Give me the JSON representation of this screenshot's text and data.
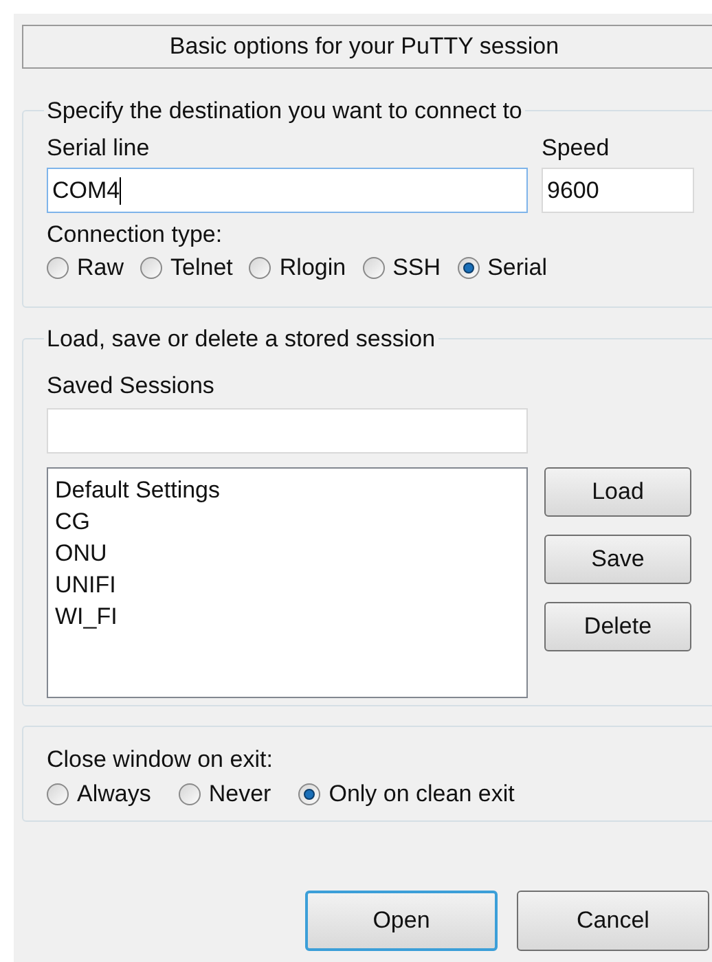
{
  "header": "Basic options for your PuTTY session",
  "destination": {
    "title": "Specify the destination you want to connect to",
    "serial_line": {
      "label": "Serial line",
      "value": "COM4",
      "focused": true
    },
    "speed": {
      "label": "Speed",
      "value": "9600"
    },
    "connection_type": {
      "label": "Connection type:",
      "options": [
        {
          "label": "Raw",
          "selected": false
        },
        {
          "label": "Telnet",
          "selected": false
        },
        {
          "label": "Rlogin",
          "selected": false
        },
        {
          "label": "SSH",
          "selected": false
        },
        {
          "label": "Serial",
          "selected": true
        }
      ]
    }
  },
  "sessions": {
    "title": "Load, save or delete a stored session",
    "saved_label": "Saved Sessions",
    "list": [
      "Default Settings",
      "CG",
      "ONU",
      "UNIFI",
      "WI_FI"
    ],
    "buttons": [
      "Load",
      "Save",
      "Delete"
    ]
  },
  "close_on_exit": {
    "label": "Close window on exit:",
    "options": [
      {
        "label": "Always",
        "selected": false
      },
      {
        "label": "Never",
        "selected": false
      },
      {
        "label": "Only on clean exit",
        "selected": true
      }
    ]
  },
  "buttons": [
    {
      "label": "Open",
      "default": true
    },
    {
      "label": "Cancel",
      "default": false
    }
  ]
}
